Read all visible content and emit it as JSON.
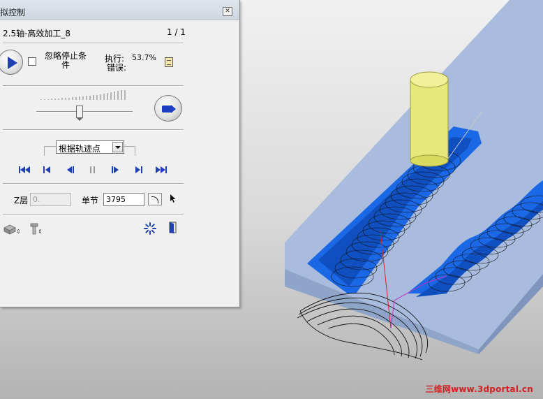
{
  "panel": {
    "title": "拟控制",
    "job_name": "2.5轴-高效加工_8",
    "page_indicator": "1 / 1",
    "ignore_stop_label": "忽略停止条件",
    "execute_label": "执行:",
    "execute_value": "53.7%",
    "error_label": "错误:",
    "mode_select_value": "根据轨迹点",
    "z_layer_label": "Z层",
    "z_layer_value": "0.",
    "step_label": "单节",
    "step_value": "3795",
    "speed_level": 0.45
  },
  "playback_controls": [
    {
      "name": "go-start-icon"
    },
    {
      "name": "step-back-icon"
    },
    {
      "name": "reverse-play-icon"
    },
    {
      "name": "pause-icon"
    },
    {
      "name": "forward-play-icon"
    },
    {
      "name": "step-forward-icon"
    },
    {
      "name": "go-end-icon"
    }
  ],
  "colors": {
    "accent_blue": "#1f3fb8",
    "pocket_blue": "#1a68e6",
    "block_face": "#a9bcdd",
    "tool_yellow": "#eaea7a"
  },
  "watermark": "三维网www.3dportal.cn"
}
